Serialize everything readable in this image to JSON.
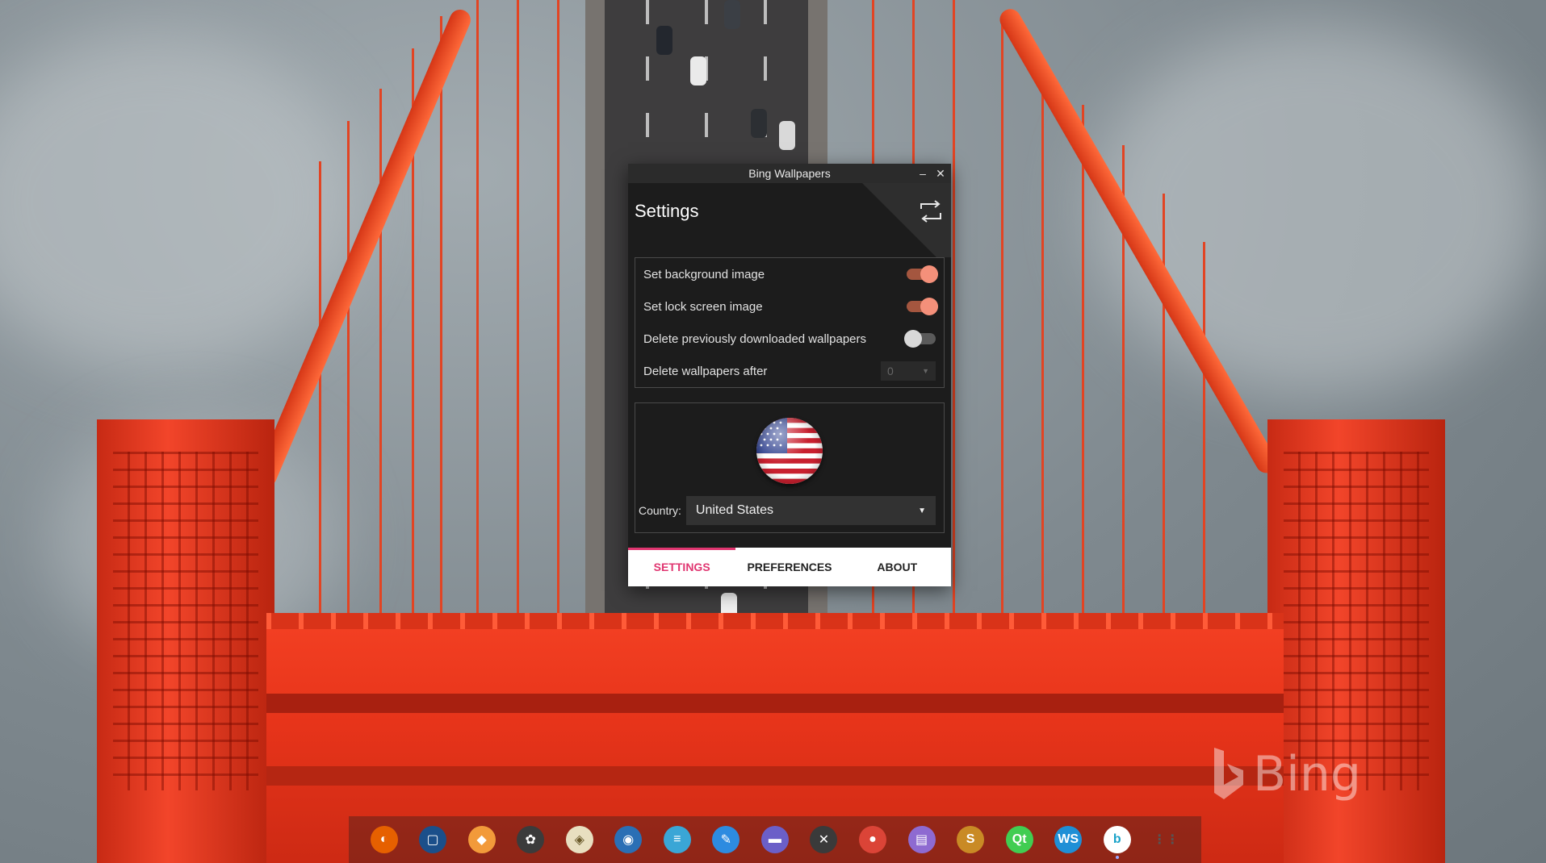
{
  "window": {
    "title": "Bing Wallpapers",
    "minimize_glyph": "–",
    "close_glyph": "✕"
  },
  "settings": {
    "heading": "Settings",
    "sync_icon": "sync-arrows-icon",
    "rows": [
      {
        "label": "Set background image",
        "state": true
      },
      {
        "label": "Set lock screen image",
        "state": true
      },
      {
        "label": "Delete previously downloaded wallpapers",
        "state": false
      }
    ],
    "delete_after": {
      "label": "Delete wallpapers after",
      "value": "0"
    }
  },
  "country": {
    "label": "Country:",
    "selected": "United States",
    "flag_icon": "us-flag-icon"
  },
  "tabs": [
    {
      "label": "SETTINGS",
      "active": true
    },
    {
      "label": "PREFERENCES",
      "active": false
    },
    {
      "label": "ABOUT",
      "active": false
    }
  ],
  "watermark": {
    "text": "Bing"
  },
  "dock": [
    {
      "name": "firefox-icon",
      "color": "#e66000",
      "glyph": "◐"
    },
    {
      "name": "virtualbox-icon",
      "color": "#1b4f8a",
      "glyph": "▢"
    },
    {
      "name": "fox-app-icon",
      "color": "#f29a3a",
      "glyph": "◆"
    },
    {
      "name": "color-picker-icon",
      "color": "#3b3b3b",
      "glyph": "✿"
    },
    {
      "name": "inkscape-icon",
      "color": "#e8dfc0",
      "glyph": "◈"
    },
    {
      "name": "blender-icon",
      "color": "#2a6fb5",
      "glyph": "◉"
    },
    {
      "name": "docs-icon",
      "color": "#3aa6d6",
      "glyph": "≡"
    },
    {
      "name": "feather-icon",
      "color": "#2d8be0",
      "glyph": "✎"
    },
    {
      "name": "files-icon",
      "color": "#6b5fc8",
      "glyph": "▬"
    },
    {
      "name": "tools-icon",
      "color": "#3a3a3a",
      "glyph": "✕"
    },
    {
      "name": "chrome-icon",
      "color": "#db4437",
      "glyph": "●"
    },
    {
      "name": "notes-icon",
      "color": "#8e6ad1",
      "glyph": "▤"
    },
    {
      "name": "sublime-icon",
      "color": "#c98a25",
      "glyph": "S"
    },
    {
      "name": "qt-icon",
      "color": "#41cd52",
      "glyph": "Qt"
    },
    {
      "name": "webstorm-icon",
      "color": "#1f8fd6",
      "glyph": "WS"
    },
    {
      "name": "bing-wallpapers-icon",
      "color": "#ffffff",
      "glyph": "b",
      "running": true
    },
    {
      "name": "app-launcher-icon",
      "color": "#2a2a2a",
      "glyph": "⋮⋮"
    }
  ]
}
